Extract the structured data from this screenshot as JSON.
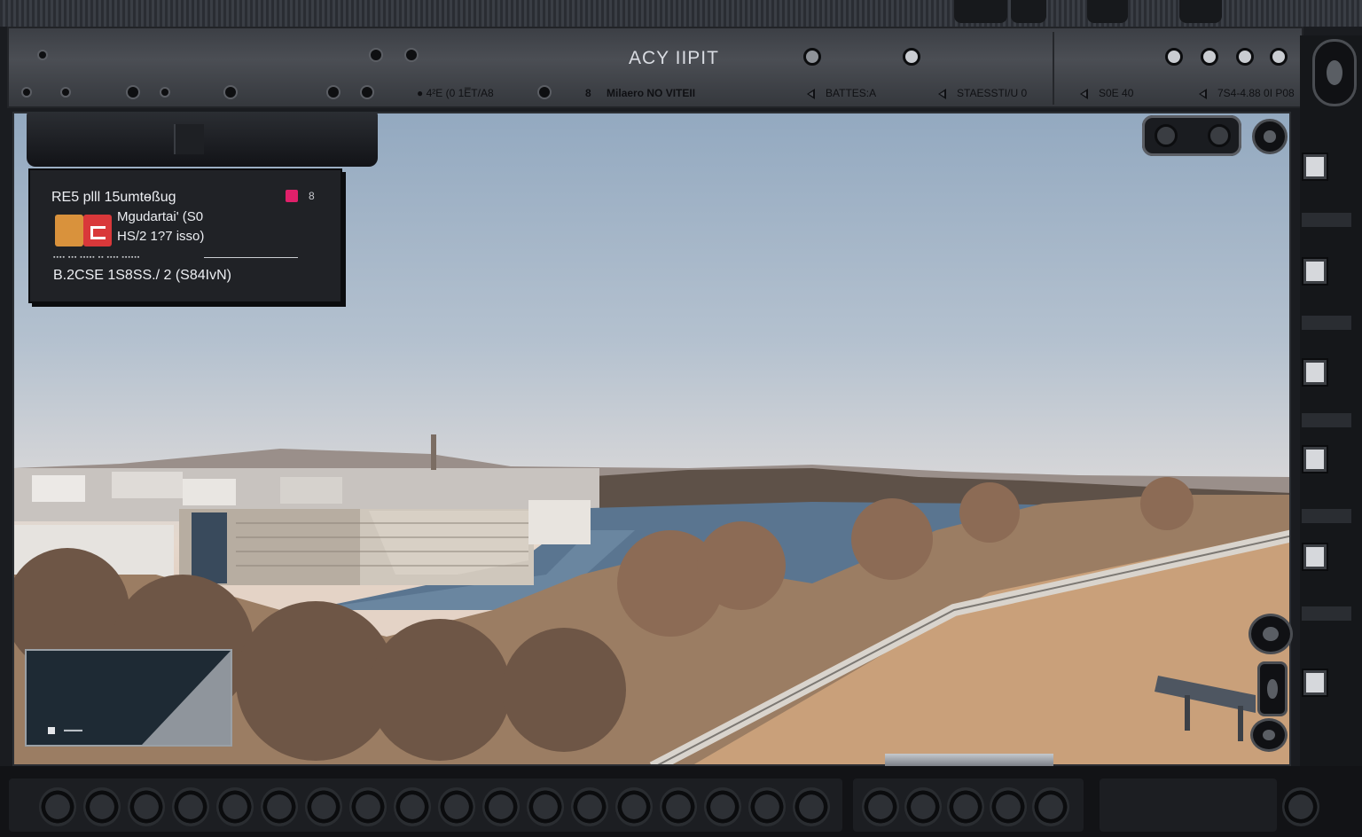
{
  "status_bar": {
    "title": "ACY IIPIT",
    "item_1": "4²E (0 1E̅T/A8",
    "item_2_prefix": "8",
    "item_2": "Milaero NO VITEII",
    "item_3": "BATTES:A",
    "item_4": "STAESSTI/U 0",
    "item_5": "S0E 40",
    "item_6": "7S4-4.88 0I P08"
  },
  "info_panel": {
    "line_1": "RE5 plll 15umtɵßuɡ",
    "line_2": "Mgudartai' (S0",
    "line_3": "HS/2 1?7 isso)",
    "line_4": "B.2CSE  1S8SS./ 2 (S84IvN)",
    "indicator": "8",
    "micro_text": "▪▪▪▪ ▪▪▪ ▪▪▪▪▪ ▪▪ ▪▪▪▪ ▪▪▪▪▪▪"
  },
  "bottom_box": {
    "label": "▬▬▬"
  },
  "colors": {
    "rec_indicator": "#e0206a",
    "chip_orange": "#d9923c",
    "chip_red": "#d9383a",
    "water": "#5a7590"
  },
  "icons": [
    "screw-icon",
    "ring-icon",
    "triangle-left-icon",
    "record-icon",
    "camera-icon",
    "sensor-icon",
    "port-icon"
  ]
}
